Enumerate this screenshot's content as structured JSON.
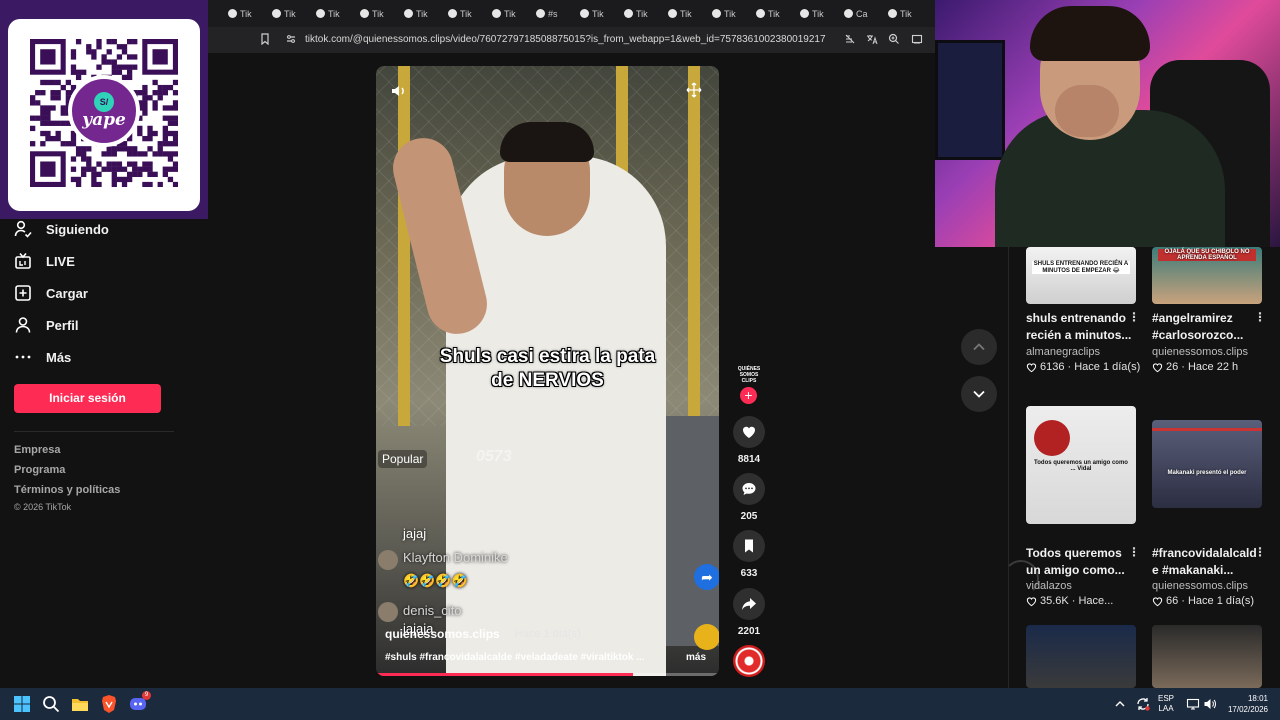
{
  "browser": {
    "tabs": [
      {
        "label": "Tik"
      },
      {
        "label": "Tik"
      },
      {
        "label": "Tik"
      },
      {
        "label": "Tik"
      },
      {
        "label": "Tik"
      },
      {
        "label": "Tik"
      },
      {
        "label": "Tik"
      },
      {
        "label": "Tik"
      },
      {
        "label": "Tik"
      },
      {
        "label": "Tik"
      },
      {
        "label": "Tik"
      },
      {
        "label": "Tik"
      },
      {
        "label": "#s"
      },
      {
        "label": "Tik"
      },
      {
        "label": "Tik"
      },
      {
        "label": "Tik"
      },
      {
        "label": "Tik"
      },
      {
        "label": "Tik"
      },
      {
        "label": "Tik"
      },
      {
        "label": "Ca"
      },
      {
        "label": "Tik"
      }
    ],
    "url": "tiktok.com/@quienessomos.clips/video/7607279718508875015?is_from_webapp=1&web_id=7578361002380019217"
  },
  "qr": {
    "brand": "yape",
    "coin": "S/"
  },
  "sidebar": {
    "items": [
      {
        "label": "Siguiendo",
        "icon": "following-icon"
      },
      {
        "label": "LIVE",
        "icon": "live-icon"
      },
      {
        "label": "Cargar",
        "icon": "upload-icon"
      },
      {
        "label": "Perfil",
        "icon": "profile-icon"
      },
      {
        "label": "Más",
        "icon": "more-icon"
      }
    ],
    "login_label": "Iniciar sesión",
    "footer": [
      "Empresa",
      "Programa",
      "Términos y políticas",
      "© 2026 TikTok"
    ]
  },
  "video": {
    "caption_line1": "Shuls casi estira la pata",
    "caption_line2": "de NERVIOS",
    "popular_label": "Popular",
    "overlay_number": "0573",
    "comments": [
      {
        "user": "Klayfton Dominike",
        "text": "🤣🤣🤣🤣"
      },
      {
        "user": "denis_cito",
        "text": "jajaja"
      }
    ],
    "partial_comment": "jajaj",
    "author": "quienessomos.clips",
    "posted": "· Hace 1 día(s)",
    "hashtags": "#shuls #francovidalalcalde #veladadeate #viraltiktok ...",
    "more_label": "más",
    "progress": 0.75
  },
  "actions": {
    "creator_logo": "QUIÉNES SOMOS CLIPS",
    "likes": "8814",
    "comments": "205",
    "saves": "633",
    "shares": "2201"
  },
  "recommendations": [
    {
      "thumb_text": "SHULS ENTRENANDO RECIÉN A MINUTOS DE EMPEZAR 😂",
      "title_line1": "shuls entrenando",
      "title_line2": "recién a minutos...",
      "author": "almanegraclips",
      "likes": "6136",
      "time": "· Hace 1 día(s)"
    },
    {
      "thumb_text": "OJALÁ QUE SU CHIBOLO NO APRENDA ESPAÑOL",
      "title_line1": "#angelramirez",
      "title_line2": "#carlosorozco...",
      "author": "quienessomos.clips",
      "likes": "26",
      "time": "· Hace 22 h"
    },
    {
      "thumb_text": "Todos queremos un amigo como ... Vidal",
      "title_line1": "Todos queremos",
      "title_line2": "un amigo como...",
      "author": "vidalazos",
      "likes": "35.6K",
      "time": "· Hace..."
    },
    {
      "thumb_text": "Makanaki presentó el poder",
      "title_line1": "#francovidalalcald",
      "title_line2": "e #makanaki...",
      "author": "quienessomos.clips",
      "likes": "66",
      "time": "· Hace 1 día(s)"
    }
  ],
  "taskbar": {
    "lang_line1": "ESP",
    "lang_line2": "LAA",
    "time": "18:01",
    "date": "17/02/2026",
    "discord_badge": "9"
  },
  "colors": {
    "accent": "#fe2c55",
    "background": "#121212",
    "yape_purple": "#74288f"
  }
}
